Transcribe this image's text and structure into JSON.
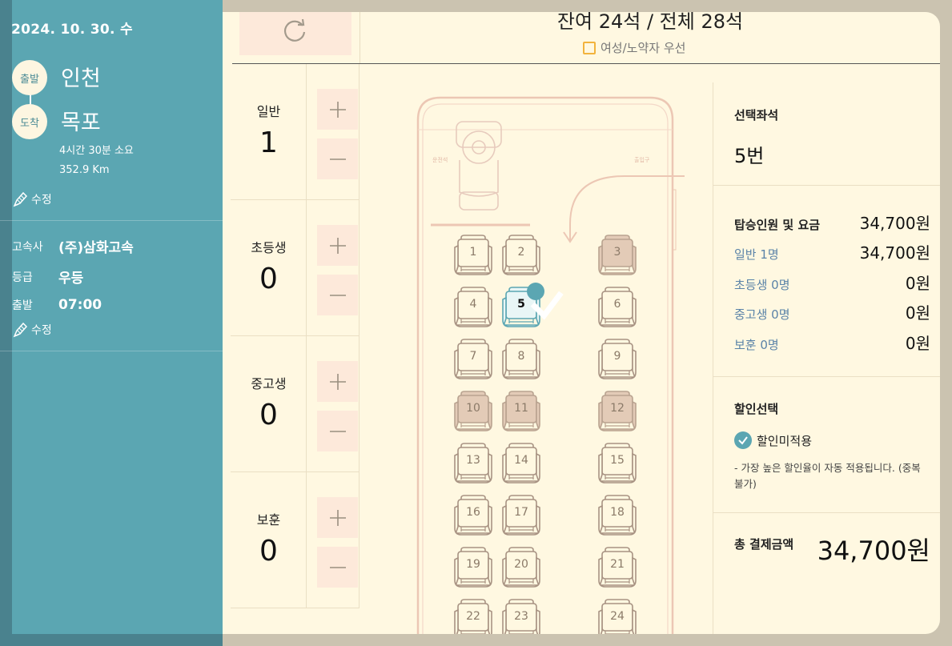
{
  "trip": {
    "date": "2024. 10. 30. 수",
    "depart_badge": "출발",
    "arrive_badge": "도착",
    "from": "인천",
    "to": "목포",
    "duration": "4시간 30분 소요",
    "distance": "352.9 Km",
    "edit_label": "수정"
  },
  "bus": {
    "company_key": "고속사",
    "company": "(주)삼화고속",
    "grade_key": "등급",
    "grade": "우등",
    "depart_key": "출발",
    "depart_time": "07:00",
    "edit_label": "수정"
  },
  "header": {
    "availability": "잔여 24석 / 전체 28석",
    "priority_label": "여성/노약자 우선"
  },
  "passengers": [
    {
      "label": "일반",
      "count": "1"
    },
    {
      "label": "초등생",
      "count": "0"
    },
    {
      "label": "중고생",
      "count": "0"
    },
    {
      "label": "보훈",
      "count": "0"
    }
  ],
  "counter_icons": {
    "plus": "plus-icon",
    "minus": "minus-icon"
  },
  "bus_map": {
    "driver_label": "운전석",
    "door_label": "출입구"
  },
  "seats": [
    {
      "n": "1",
      "state": "free"
    },
    {
      "n": "2",
      "state": "free"
    },
    {
      "n": "3",
      "state": "taken"
    },
    {
      "n": "4",
      "state": "free"
    },
    {
      "n": "5",
      "state": "selected"
    },
    {
      "n": "6",
      "state": "free"
    },
    {
      "n": "7",
      "state": "free"
    },
    {
      "n": "8",
      "state": "free"
    },
    {
      "n": "9",
      "state": "free"
    },
    {
      "n": "10",
      "state": "taken"
    },
    {
      "n": "11",
      "state": "taken"
    },
    {
      "n": "12",
      "state": "taken"
    },
    {
      "n": "13",
      "state": "free"
    },
    {
      "n": "14",
      "state": "free"
    },
    {
      "n": "15",
      "state": "free"
    },
    {
      "n": "16",
      "state": "free"
    },
    {
      "n": "17",
      "state": "free"
    },
    {
      "n": "18",
      "state": "free"
    },
    {
      "n": "19",
      "state": "free"
    },
    {
      "n": "20",
      "state": "free"
    },
    {
      "n": "21",
      "state": "free"
    },
    {
      "n": "22",
      "state": "free"
    },
    {
      "n": "23",
      "state": "free"
    },
    {
      "n": "24",
      "state": "free"
    }
  ],
  "summary": {
    "selected_title": "선택좌석",
    "selected_seat": "5번",
    "fare_title": "탑승인원 및 요금",
    "fare_total": "34,700원",
    "rows": [
      {
        "label": "일반 1명",
        "value": "34,700원"
      },
      {
        "label": "초등생 0명",
        "value": "0원"
      },
      {
        "label": "중고생 0명",
        "value": "0원"
      },
      {
        "label": "보훈 0명",
        "value": "0원"
      }
    ],
    "discount_title": "할인선택",
    "discount_option": "할인미적용",
    "discount_note": "- 가장 높은 할인율이 자동 적용됩니다. (중복불가)",
    "total_label": "총 결제금액",
    "total_value": "34,700원"
  },
  "colors": {
    "panel": "#5ba6b2",
    "sheet": "#fff8e1",
    "button_bg": "#fde9da",
    "accent": "#5ba6b2",
    "checkbox": "#f2b33d"
  }
}
